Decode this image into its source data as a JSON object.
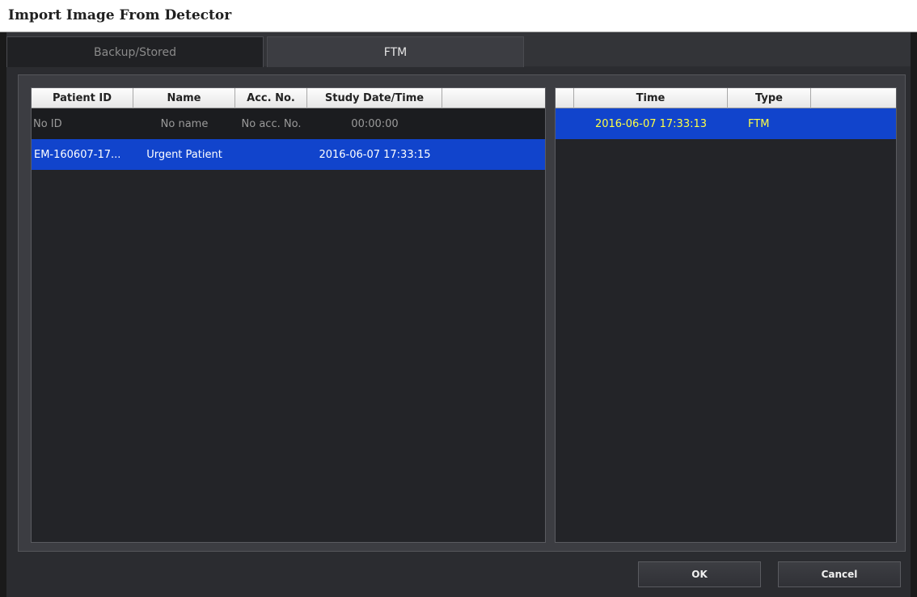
{
  "window": {
    "title": "Import Image From Detector"
  },
  "tabs": [
    {
      "label": "Backup/Stored"
    },
    {
      "label": "FTM"
    }
  ],
  "studies": {
    "columns": [
      "Patient ID",
      "Name",
      "Acc. No.",
      "Study Date/Time"
    ],
    "rows": [
      {
        "patient_id": "No ID",
        "name": "No name",
        "acc_no": "No acc. No.",
        "study_datetime": "00:00:00"
      },
      {
        "patient_id": "EM-160607-17...",
        "name": "Urgent Patient",
        "acc_no": "",
        "study_datetime": "2016-06-07 17:33:15"
      }
    ]
  },
  "images": {
    "columns": [
      "Time",
      "Type"
    ],
    "rows": [
      {
        "time": "2016-06-07 17:33:13",
        "type": "FTM"
      }
    ]
  },
  "buttons": {
    "ok": "OK",
    "cancel": "Cancel"
  },
  "colors": {
    "selection": "#1144cc",
    "selection_text_right": "#ffff44"
  }
}
